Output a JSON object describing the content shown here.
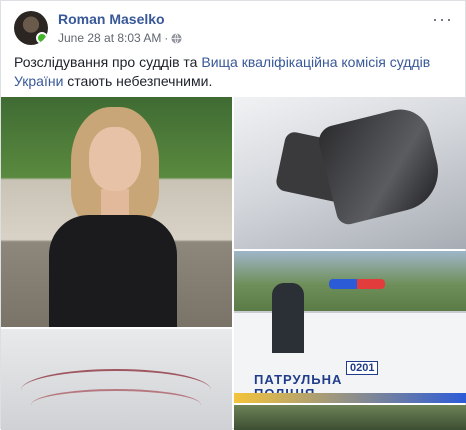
{
  "post": {
    "author": "Roman Maselko",
    "timestamp": "June 28 at 8:03 AM",
    "separator": "·",
    "more_icon": "···",
    "text_before": "Розслідування про суддів та ",
    "link_text": "Вища кваліфікаційна комісія суддів України",
    "text_after": " стають небезпечними."
  },
  "photos": {
    "police_car_text_line1": "ПАТРУЛЬНА",
    "police_car_text_line2": "ПОЛІЦІЯ",
    "police_car_number": "0201"
  },
  "colors": {
    "link": "#385898",
    "online": "#42b72a"
  },
  "icons": {
    "privacy": "globe-icon",
    "menu": "more-icon"
  }
}
